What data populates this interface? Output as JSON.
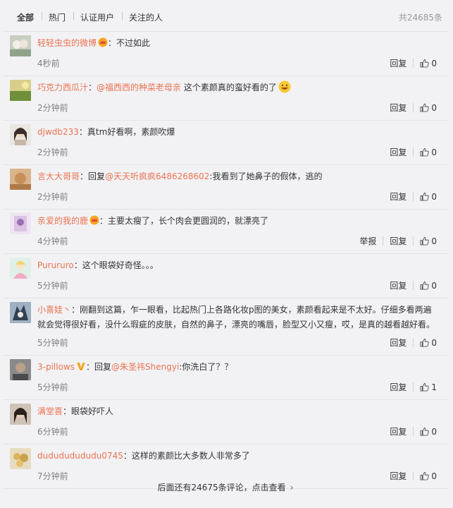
{
  "tabs": [
    {
      "label": "全部"
    },
    {
      "label": "热门"
    },
    {
      "label": "认证用户"
    },
    {
      "label": "关注的人"
    }
  ],
  "total_count": "共24685条",
  "actions": {
    "reply_label": "回复",
    "report_label": "举报"
  },
  "comments": [
    {
      "user": "轻轻虫虫的微博",
      "badge": "crown-icon",
      "sep": "：",
      "content": "不过如此",
      "time": "4秒前",
      "likes": "0"
    },
    {
      "user": "巧克力西瓜汁",
      "sep": "：",
      "mention": "@福西西的种菜老母亲",
      "content": " 这个素颜真的蛮好看的了",
      "emoji": "smile-emoji",
      "time": "2分钟前",
      "likes": "0"
    },
    {
      "user": "djwdb233",
      "sep": "：",
      "content": "真tm好看啊，素颜吹爆",
      "time": "2分钟前",
      "likes": "0"
    },
    {
      "user": "言大大哥哥",
      "sep": "：",
      "prefix": "回复",
      "mention": "@天天听疯疯6486268602",
      "content": ":我看到了她鼻子的假体，逃的",
      "time": "2分钟前",
      "likes": "0"
    },
    {
      "user": "亲爱的我的鹿",
      "badge": "crown-icon",
      "sep": "：",
      "content": "主要太瘦了，长个肉会更圆润的，就漂亮了",
      "time": "4分钟前",
      "likes": "0",
      "report": true
    },
    {
      "user": "Purururo",
      "sep": "：",
      "content": "这个眼袋好奇怪。。。",
      "time": "5分钟前",
      "likes": "0"
    },
    {
      "user": "小喜娃丶",
      "sep": "：",
      "content": "刚翻到这篇，乍一眼看，比起热门上各路化妆p图的美女，素颜看起来是不太好。仔细多看两遍就会觉得很好看，没什么瑕疵的皮肤，自然的鼻子，漂亮的嘴唇，脸型又小又瘦，哎，是真的越看越好看。",
      "time": "5分钟前",
      "likes": "0"
    },
    {
      "user": "3-pillows",
      "badge": "v-icon",
      "sep": "：",
      "prefix": "回复",
      "mention": "@朱圣祎Shengyi",
      "content": ":你洗白了？？",
      "time": "5分钟前",
      "likes": "1"
    },
    {
      "user": "满堂喜",
      "sep": "：",
      "content": "眼袋好吓人",
      "time": "6分钟前",
      "likes": "0"
    },
    {
      "user": "dudududududu0745",
      "sep": "：",
      "content": "这样的素颜比大多数人非常多了",
      "time": "7分钟前",
      "likes": "0"
    }
  ],
  "more_label": "后面还有24675条评论，点击查看",
  "colors": {
    "accent": "#eb7350",
    "background": "#f2f2f5",
    "divider": "#e3e3e8"
  }
}
